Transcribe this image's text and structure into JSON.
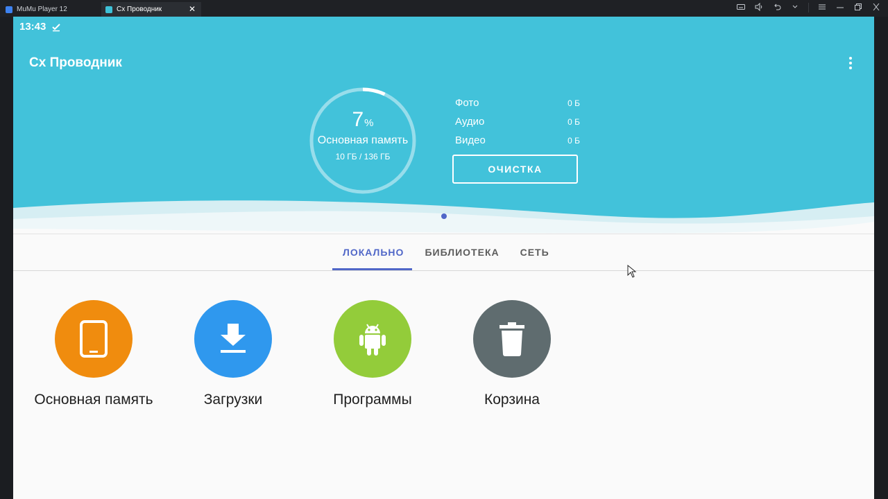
{
  "emulator": {
    "tabs": [
      {
        "label": "MuMu Player 12"
      },
      {
        "label": "Сх Проводник"
      }
    ],
    "close_glyph": "✕"
  },
  "statusbar": {
    "time": "13:43"
  },
  "app": {
    "title": "Сх Проводник"
  },
  "storage": {
    "percent": "7",
    "percent_sign": "%",
    "used_fraction": 0.07,
    "label": "Основная память",
    "size": "10 ГБ / 136 ГБ"
  },
  "stats": [
    {
      "label": "Фото",
      "value": "0 Б"
    },
    {
      "label": "Аудио",
      "value": "0 Б"
    },
    {
      "label": "Видео",
      "value": "0 Б"
    }
  ],
  "clean_button": {
    "label": "ОЧИСТКА"
  },
  "tabs": [
    {
      "label": "ЛОКАЛЬНО",
      "active": true
    },
    {
      "label": "БИБЛИОТЕКА",
      "active": false
    },
    {
      "label": "СЕТЬ",
      "active": false
    }
  ],
  "shortcuts": [
    {
      "label": "Основная память",
      "icon": "tablet-icon",
      "color": "#f08c0e"
    },
    {
      "label": "Загрузки",
      "icon": "download-icon",
      "color": "#2f98ee"
    },
    {
      "label": "Программы",
      "icon": "android-icon",
      "color": "#93cc3a"
    },
    {
      "label": "Корзина",
      "icon": "trash-icon",
      "color": "#5f6c6f"
    }
  ],
  "colors": {
    "header": "#42c2da",
    "accent": "#5067c8"
  }
}
